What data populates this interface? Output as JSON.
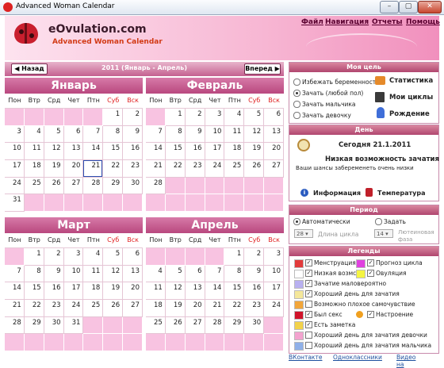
{
  "window": {
    "title": "Advanced Woman Calendar"
  },
  "header": {
    "brand": "eOvulation.com",
    "subtitle": "Advanced Woman Calendar"
  },
  "menu": {
    "file": "Файл",
    "nav": "Навигация",
    "reports": "Отчеты",
    "help": "Помощь"
  },
  "nav": {
    "back": "Назад",
    "forward": "Вперед",
    "range": "2011 (Январь - Апрель)"
  },
  "weekdays": [
    "Пон",
    "Втр",
    "Срд",
    "Чет",
    "Птн",
    "Суб",
    "Вск"
  ],
  "months": [
    {
      "name": "Январь",
      "start": 5,
      "days": 31
    },
    {
      "name": "Февраль",
      "start": 1,
      "days": 28
    },
    {
      "name": "Март",
      "start": 1,
      "days": 31
    },
    {
      "name": "Апрель",
      "start": 4,
      "days": 30
    }
  ],
  "today": {
    "month": 0,
    "day": 21
  },
  "goal": {
    "title": "Моя цель",
    "options": [
      "Избежать беременности",
      "Зачать (любой пол)",
      "Зачать мальчика",
      "Зачать девочку"
    ],
    "selected": 1,
    "buttons": {
      "stats": "Статистика",
      "cycles": "Мои циклы",
      "birth": "Рождение"
    }
  },
  "day": {
    "title": "День",
    "date": "Сегодня 21.1.2011",
    "status": "Низкая возможность зачатия",
    "desc": "Ваши шансы забеременеть очень низки",
    "info": "Информация",
    "temp": "Температура"
  },
  "period": {
    "title": "Период",
    "auto": "Автоматически",
    "set": "Задать",
    "cycle_value": "28",
    "cycle_label": "Длина цикла",
    "luteal_value": "14",
    "luteal_label1": "Лютеиновая",
    "luteal_label2": "фаза"
  },
  "legends": {
    "title": "Легенды",
    "row1": [
      {
        "label": "Менструация",
        "color": "#e23b3b"
      },
      {
        "label": "Прогноз цикла",
        "color": "#e040e0"
      }
    ],
    "row2": [
      {
        "label": "Низкая возмс",
        "color": "#ffffff"
      },
      {
        "label": "Овуляция",
        "color": "#f5f542"
      }
    ],
    "items": [
      {
        "label": "Зачатие маловероятно",
        "color": "#b8b0f0",
        "checked": true
      },
      {
        "label": "Хороший день для зачатия",
        "color": "#f4e79a",
        "checked": true
      },
      {
        "label": "Возможно плохое самочувствие",
        "color": "#f2a63a",
        "checked": false
      },
      {
        "label": "Был секс",
        "color": "#d0142a",
        "checked": true
      },
      {
        "label": "Есть заметка",
        "color": "#f2d24a",
        "checked": true
      },
      {
        "label": "Хороший день для зачатия девочки",
        "color": "#f3a3cf",
        "checked": false
      },
      {
        "label": "Хороший день для зачатия мальчика",
        "color": "#8fb0e8",
        "checked": false
      }
    ],
    "mood": "Настроение"
  },
  "footer": {
    "vk": "ВКонтакте",
    "ok": "Одноклассники",
    "video": "Видео на"
  },
  "colors": {
    "accent": "#c0508a",
    "empty_cell": "#f8c3e1",
    "header_bar": "#b9487f"
  }
}
